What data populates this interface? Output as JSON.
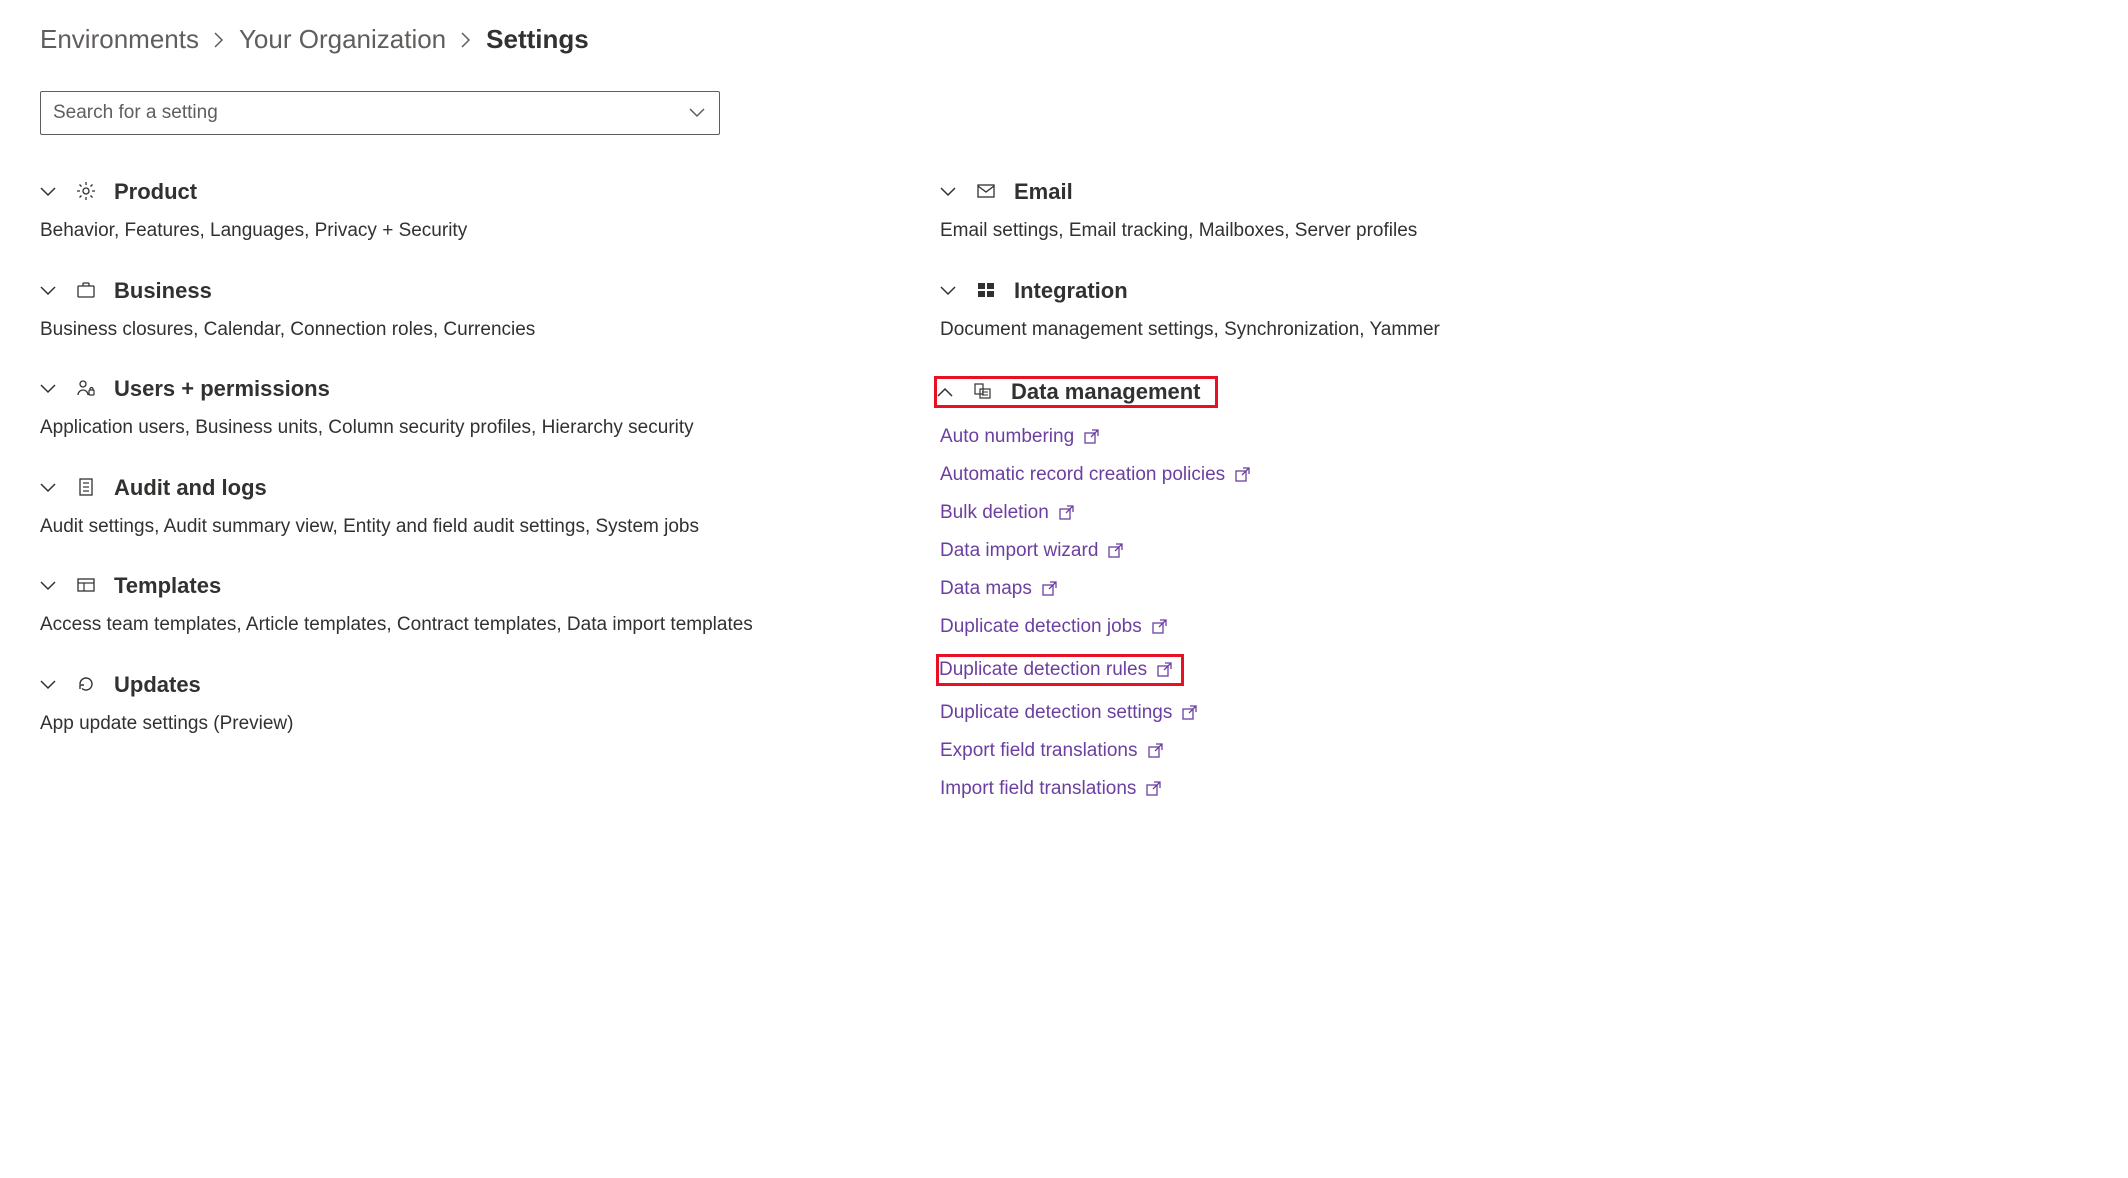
{
  "breadcrumb": {
    "items": [
      "Environments",
      "Your Organization"
    ],
    "current": "Settings"
  },
  "search": {
    "placeholder": "Search for a setting"
  },
  "left_sections": [
    {
      "id": "product",
      "title": "Product",
      "summary": "Behavior, Features, Languages, Privacy + Security",
      "expanded": false,
      "icon": "gear"
    },
    {
      "id": "business",
      "title": "Business",
      "summary": "Business closures, Calendar, Connection roles, Currencies",
      "expanded": false,
      "icon": "briefcase"
    },
    {
      "id": "users",
      "title": "Users + permissions",
      "summary": "Application users, Business units, Column security profiles, Hierarchy security",
      "expanded": false,
      "icon": "people"
    },
    {
      "id": "audit",
      "title": "Audit and logs",
      "summary": "Audit settings, Audit summary view, Entity and field audit settings, System jobs",
      "expanded": false,
      "icon": "list"
    },
    {
      "id": "templates",
      "title": "Templates",
      "summary": "Access team templates, Article templates, Contract templates, Data import templates",
      "expanded": false,
      "icon": "templates"
    },
    {
      "id": "updates",
      "title": "Updates",
      "summary": "App update settings (Preview)",
      "expanded": false,
      "icon": "refresh"
    }
  ],
  "right_sections": [
    {
      "id": "email",
      "title": "Email",
      "summary": "Email settings, Email tracking, Mailboxes, Server profiles",
      "expanded": false,
      "icon": "mail"
    },
    {
      "id": "integration",
      "title": "Integration",
      "summary": "Document management settings, Synchronization, Yammer",
      "expanded": false,
      "icon": "windows"
    },
    {
      "id": "data-management",
      "title": "Data management",
      "summary": "",
      "expanded": true,
      "icon": "database",
      "highlighted": true,
      "links": [
        {
          "label": "Auto numbering",
          "highlighted": false
        },
        {
          "label": "Automatic record creation policies",
          "highlighted": false
        },
        {
          "label": "Bulk deletion",
          "highlighted": false
        },
        {
          "label": "Data import wizard",
          "highlighted": false
        },
        {
          "label": "Data maps",
          "highlighted": false
        },
        {
          "label": "Duplicate detection jobs",
          "highlighted": false
        },
        {
          "label": "Duplicate detection rules",
          "highlighted": true
        },
        {
          "label": "Duplicate detection settings",
          "highlighted": false
        },
        {
          "label": "Export field translations",
          "highlighted": false
        },
        {
          "label": "Import field translations",
          "highlighted": false
        }
      ]
    }
  ]
}
